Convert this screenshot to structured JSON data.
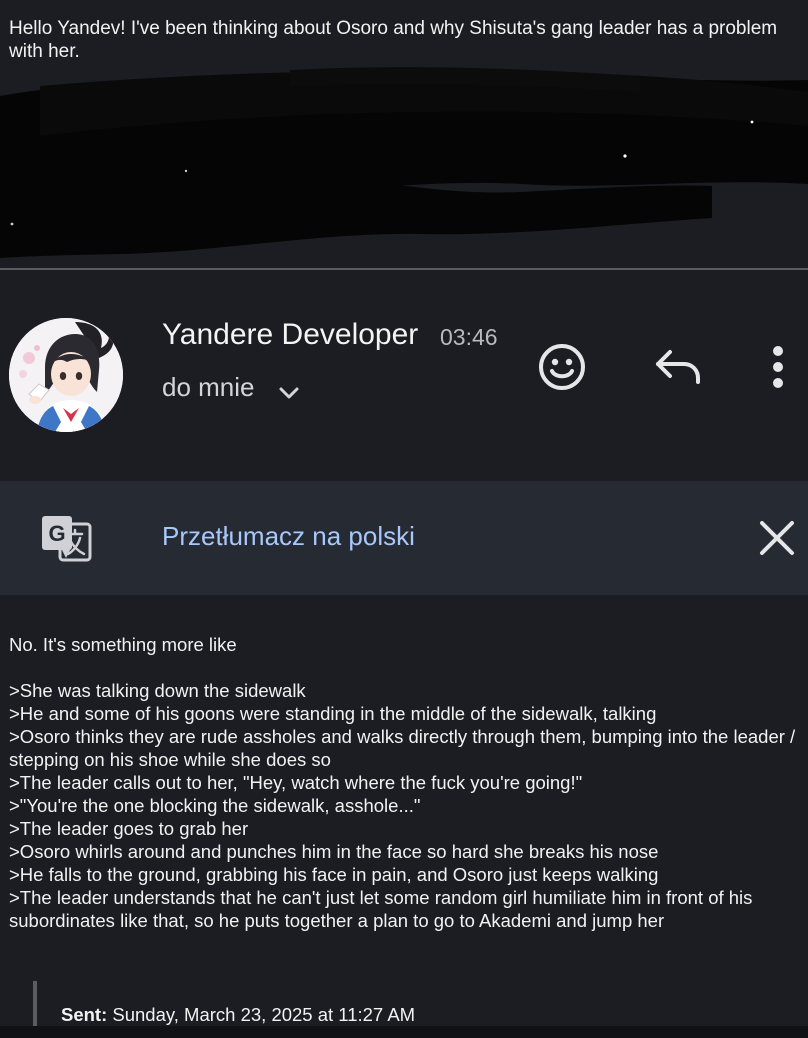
{
  "quoted": {
    "text": "Hello Yandev! I've been thinking about Osoro and why Shisuta's gang leader has a problem with her."
  },
  "header": {
    "sender_name": "Yandere Developer",
    "time": "03:46",
    "recipient": "do mnie",
    "icons": {
      "chevron": "chevron-down-icon",
      "emoji": "emoji-icon",
      "reply": "reply-icon",
      "more": "more-vert-icon"
    }
  },
  "translate": {
    "label": "Przetłumacz na polski",
    "icon": "google-translate-icon",
    "close_icon": "close-icon"
  },
  "body": {
    "intro": "No. It's something more like",
    "lines": [
      ">She was talking down the sidewalk",
      ">He and some of his goons were standing in the middle of the sidewalk, talking",
      ">Osoro thinks they are rude assholes and walks directly through them, bumping into the leader / stepping on his shoe while she does so",
      ">The leader calls out to her, \"Hey, watch where the fuck you're going!\"",
      ">\"You're the one blocking the sidewalk, asshole...\"",
      ">The leader goes to grab her",
      ">Osoro whirls around and punches him in the face so hard she breaks his nose",
      ">He falls to the ground, grabbing his face in pain, and Osoro just keeps walking",
      ">The leader understands that he can't just let some random girl humiliate him in front of his subordinates like that, so he puts together a plan to go to Akademi and jump her"
    ]
  },
  "sent": {
    "label": "Sent:",
    "value": "Sunday, March 23, 2025 at 11:27 AM"
  },
  "colors": {
    "background": "#1b1d23",
    "translate_bar": "#262a32",
    "link": "#a8c7fa",
    "text": "#f2f2f2"
  }
}
